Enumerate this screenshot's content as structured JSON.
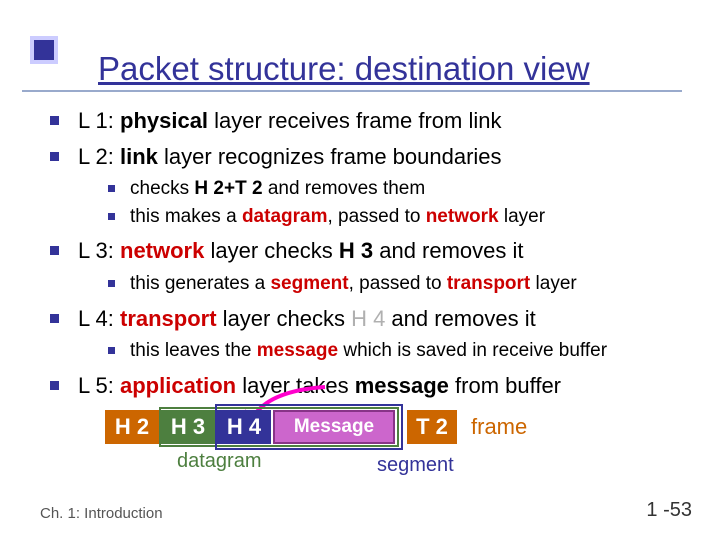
{
  "title": "Packet structure: destination view",
  "bullets": {
    "l1_pre": "L 1: ",
    "l1_b": "physical",
    "l1_post": " layer receives frame from link",
    "l2_pre": "L 2: ",
    "l2_b": "link",
    "l2_post": " layer recognizes frame boundaries",
    "l2_s1_pre": "checks ",
    "l2_s1_b": "H 2+T 2",
    "l2_s1_post": " and removes them",
    "l2_s2_pre": "this makes a ",
    "l2_s2_r1": "datagram",
    "l2_s2_mid": ", passed to ",
    "l2_s2_r2": "network",
    "l2_s2_post": " layer",
    "l3_pre": "L 3: ",
    "l3_r": "network",
    "l3_mid": " layer checks ",
    "l3_b": "H 3",
    "l3_post": " and removes it",
    "l3_s1_pre": "this generates a ",
    "l3_s1_r1": "segment",
    "l3_s1_mid": ", passed to ",
    "l3_s1_r2": "transport",
    "l3_s1_post": " layer",
    "l4_pre": "L 4: ",
    "l4_r": "transport",
    "l4_mid": " layer checks ",
    "l4_gray": "H 4",
    "l4_post": " and removes it",
    "l4_s1_pre": "this leaves the ",
    "l4_s1_r": "message",
    "l4_s1_post": " which is saved in receive buffer",
    "l5_pre": "L 5: ",
    "l5_r": "application",
    "l5_mid": " layer takes ",
    "l5_b": "message",
    "l5_post": " from buffer"
  },
  "diagram": {
    "h2": "H 2",
    "h3": "H 3",
    "h4": "H 4",
    "msg": "Message",
    "t2": "T 2",
    "frame": "frame",
    "datagram": "datagram",
    "segment": "segment"
  },
  "footer": {
    "left": "Ch. 1: Introduction",
    "right": "1 -53"
  }
}
